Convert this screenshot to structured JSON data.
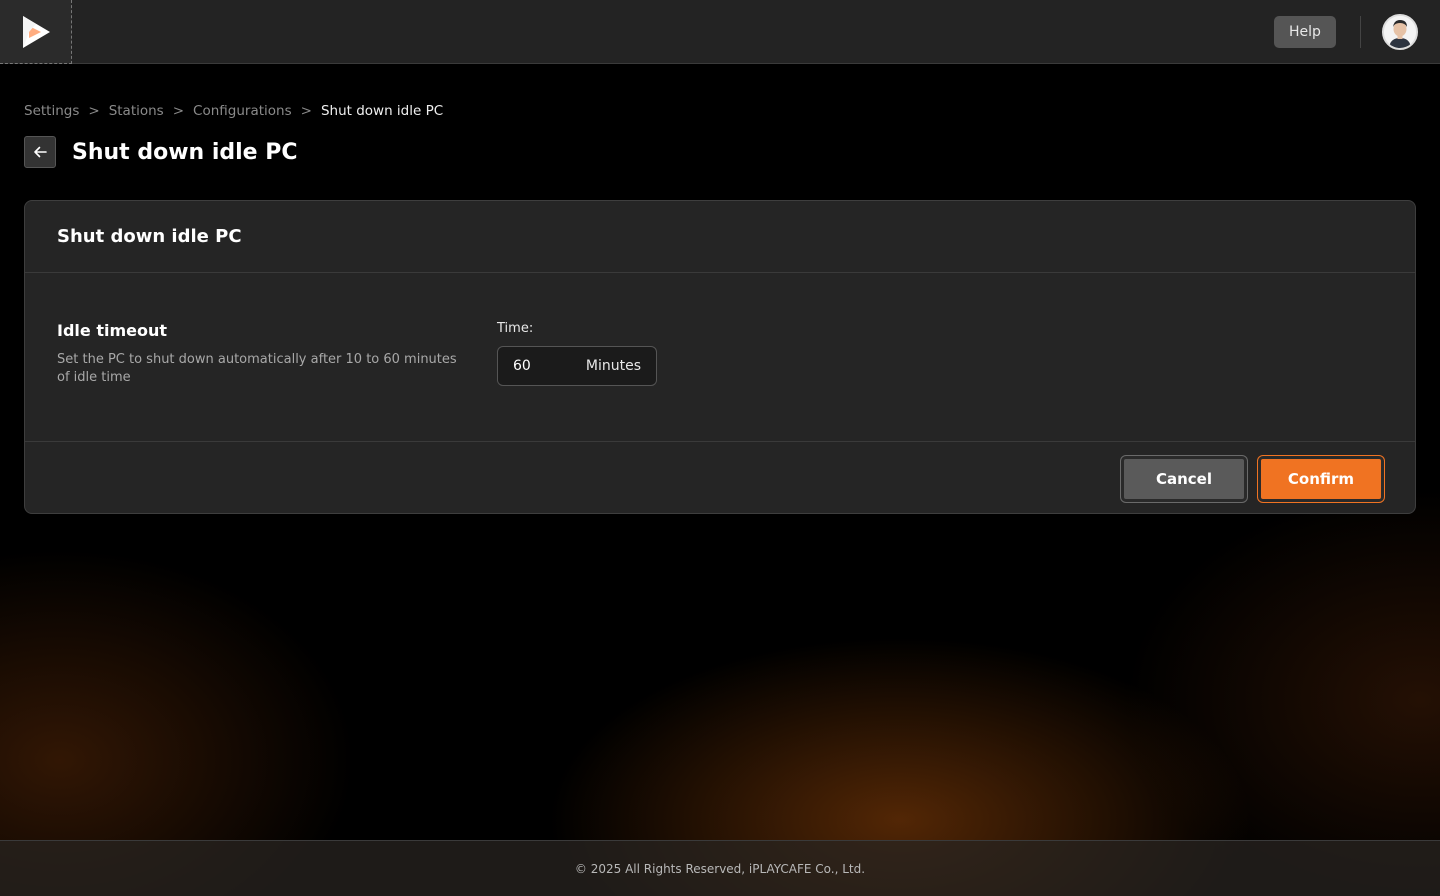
{
  "header": {
    "help_label": "Help"
  },
  "breadcrumb": {
    "items": [
      "Settings",
      "Stations",
      "Configurations",
      "Shut down idle PC"
    ],
    "separator": ">"
  },
  "page": {
    "title": "Shut down idle PC"
  },
  "card": {
    "title": "Shut down idle PC",
    "setting": {
      "title": "Idle timeout",
      "description": "Set the PC to shut down automatically after 10 to 60 minutes of idle time",
      "time_label": "Time:",
      "time_value": "60",
      "time_unit": "Minutes"
    },
    "cancel_label": "Cancel",
    "confirm_label": "Confirm"
  },
  "footer": {
    "copyright": "© 2025 All Rights Reserved, iPLAYCAFE Co., Ltd."
  },
  "colors": {
    "accent": "#f07322",
    "surface": "#262626",
    "header": "#232323"
  },
  "icons": {
    "logo": "play-logo-icon",
    "back": "arrow-left-icon",
    "avatar": "user-avatar-icon"
  }
}
